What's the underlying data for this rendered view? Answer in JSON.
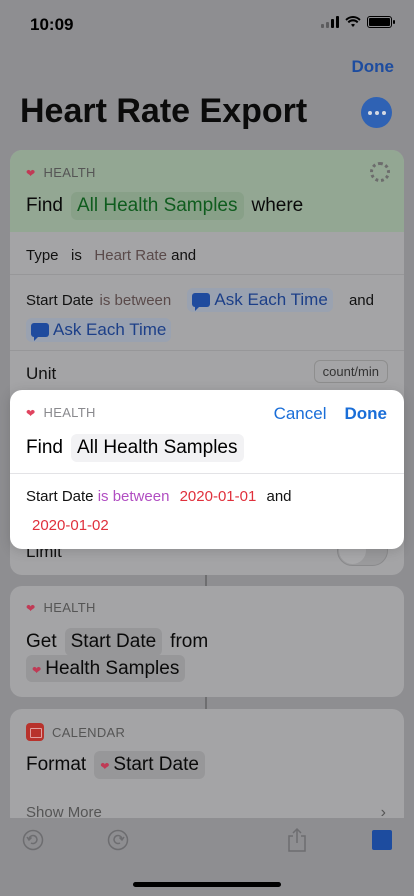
{
  "status": {
    "time": "10:09"
  },
  "nav": {
    "done": "Done",
    "title": "Heart Rate Export"
  },
  "find_card": {
    "category": "HEALTH",
    "find": "Find",
    "source": "All Health Samples",
    "where": "where",
    "type_label": "Type",
    "type_op": "is",
    "type_value": "Heart Rate",
    "type_and": "and",
    "start_label": "Start Date",
    "start_op": "is between",
    "ask1": "Ask Each Time",
    "and2": "and",
    "ask2": "Ask Each Time",
    "unit_label": "Unit",
    "unit_value": "count/min",
    "limit_label": "Limit"
  },
  "get_card": {
    "category": "HEALTH",
    "get": "Get",
    "field": "Start Date",
    "from": "from",
    "source": "Health Samples"
  },
  "calendar_card": {
    "category": "CALENDAR",
    "format": "Format",
    "field": "Start Date",
    "show_more": "Show More"
  },
  "popup": {
    "category": "HEALTH",
    "cancel": "Cancel",
    "done": "Done",
    "find": "Find",
    "source": "All Health Samples",
    "start_label": "Start Date",
    "op": "is between",
    "date1": "2020-01-01",
    "and": "and",
    "date2": "2020-01-02"
  },
  "icons": [
    "heart-icon",
    "calendar-icon",
    "undo-icon",
    "redo-icon",
    "share-icon",
    "stop-icon",
    "more-icon",
    "spinner-icon",
    "chevron-right-icon"
  ]
}
